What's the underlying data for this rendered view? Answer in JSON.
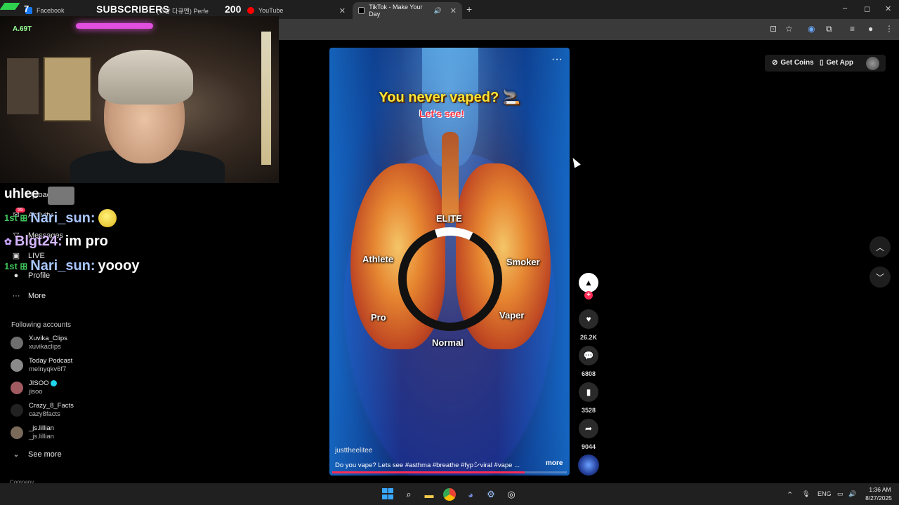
{
  "browser": {
    "tabs": [
      {
        "label": "Facebook",
        "fav_color": "#1877f2"
      },
      {
        "label": "(쯔양 다큐멘) Perfe",
        "fav_color": "#ff0000"
      },
      {
        "label": "YouTube",
        "fav_color": "#ff0000"
      },
      {
        "label": "TikTok - Make Your Day",
        "fav_color": "#000000"
      }
    ],
    "new_tab": "+",
    "window_controls": [
      "–",
      "◻",
      "✕"
    ]
  },
  "stream_overlay": {
    "seven": "7",
    "subscribers_label": "SUBSCRIBERS",
    "subscribers_count": "200",
    "cam_label": "A.69T"
  },
  "chat": {
    "top_user": "uhlee",
    "messages": [
      {
        "user": "Nari_sun:",
        "text": ""
      },
      {
        "user": "Blgt24:",
        "text": "im pro"
      },
      {
        "user": "Nari_sun:",
        "text": "yoooy"
      }
    ]
  },
  "sidebar": {
    "nav": [
      {
        "icon": "🔔",
        "label": "Upload"
      },
      {
        "icon": "✉",
        "label": "Activity",
        "badge": "55"
      },
      {
        "icon": "▽",
        "label": "Messages"
      },
      {
        "icon": "▣",
        "label": "LIVE"
      },
      {
        "icon": "●",
        "label": "Profile"
      },
      {
        "icon": "···",
        "label": "More"
      }
    ],
    "following_title": "Following accounts",
    "accounts": [
      {
        "name": "Xuvika_Clips",
        "handle": "xuvikaclips",
        "color": "#6f6f6f"
      },
      {
        "name": "Today Podcast",
        "handle": "melnyqkv6f7",
        "color": "#8a8a8a"
      },
      {
        "name": "JISOO",
        "handle": "jisoo",
        "color": "#a05a60",
        "verified": true
      },
      {
        "name": "Crazy_8_Facts",
        "handle": "cazy8facts",
        "color": "#222"
      },
      {
        "name": "_js.lillian",
        "handle": "_js.lillian",
        "color": "#7a6a5a"
      }
    ],
    "see_more": "See more",
    "company": "Company"
  },
  "video": {
    "title": "You never vaped? 🚬",
    "subtitle": "Let's see!",
    "labels": {
      "elite": "ELITE",
      "athlete": "Athlete",
      "smoker": "Smoker",
      "pro": "Pro",
      "vaper": "Vaper",
      "normal": "Normal"
    },
    "ring_progress": 0.12,
    "author": "justtheelitee",
    "caption": "Do you vape? Lets see  #asthma  #breathe  #fypシviral  #vape  ...",
    "more": "more",
    "playback_progress": 0.82
  },
  "rail": {
    "likes": "26.2K",
    "comments": "6808",
    "saves": "3528",
    "shares": "9044"
  },
  "header": {
    "get_coins": "Get Coins",
    "get_app": "Get App"
  },
  "taskbar": {
    "language": "ENG",
    "time": "1:36 AM",
    "date": "8/27/2025"
  }
}
